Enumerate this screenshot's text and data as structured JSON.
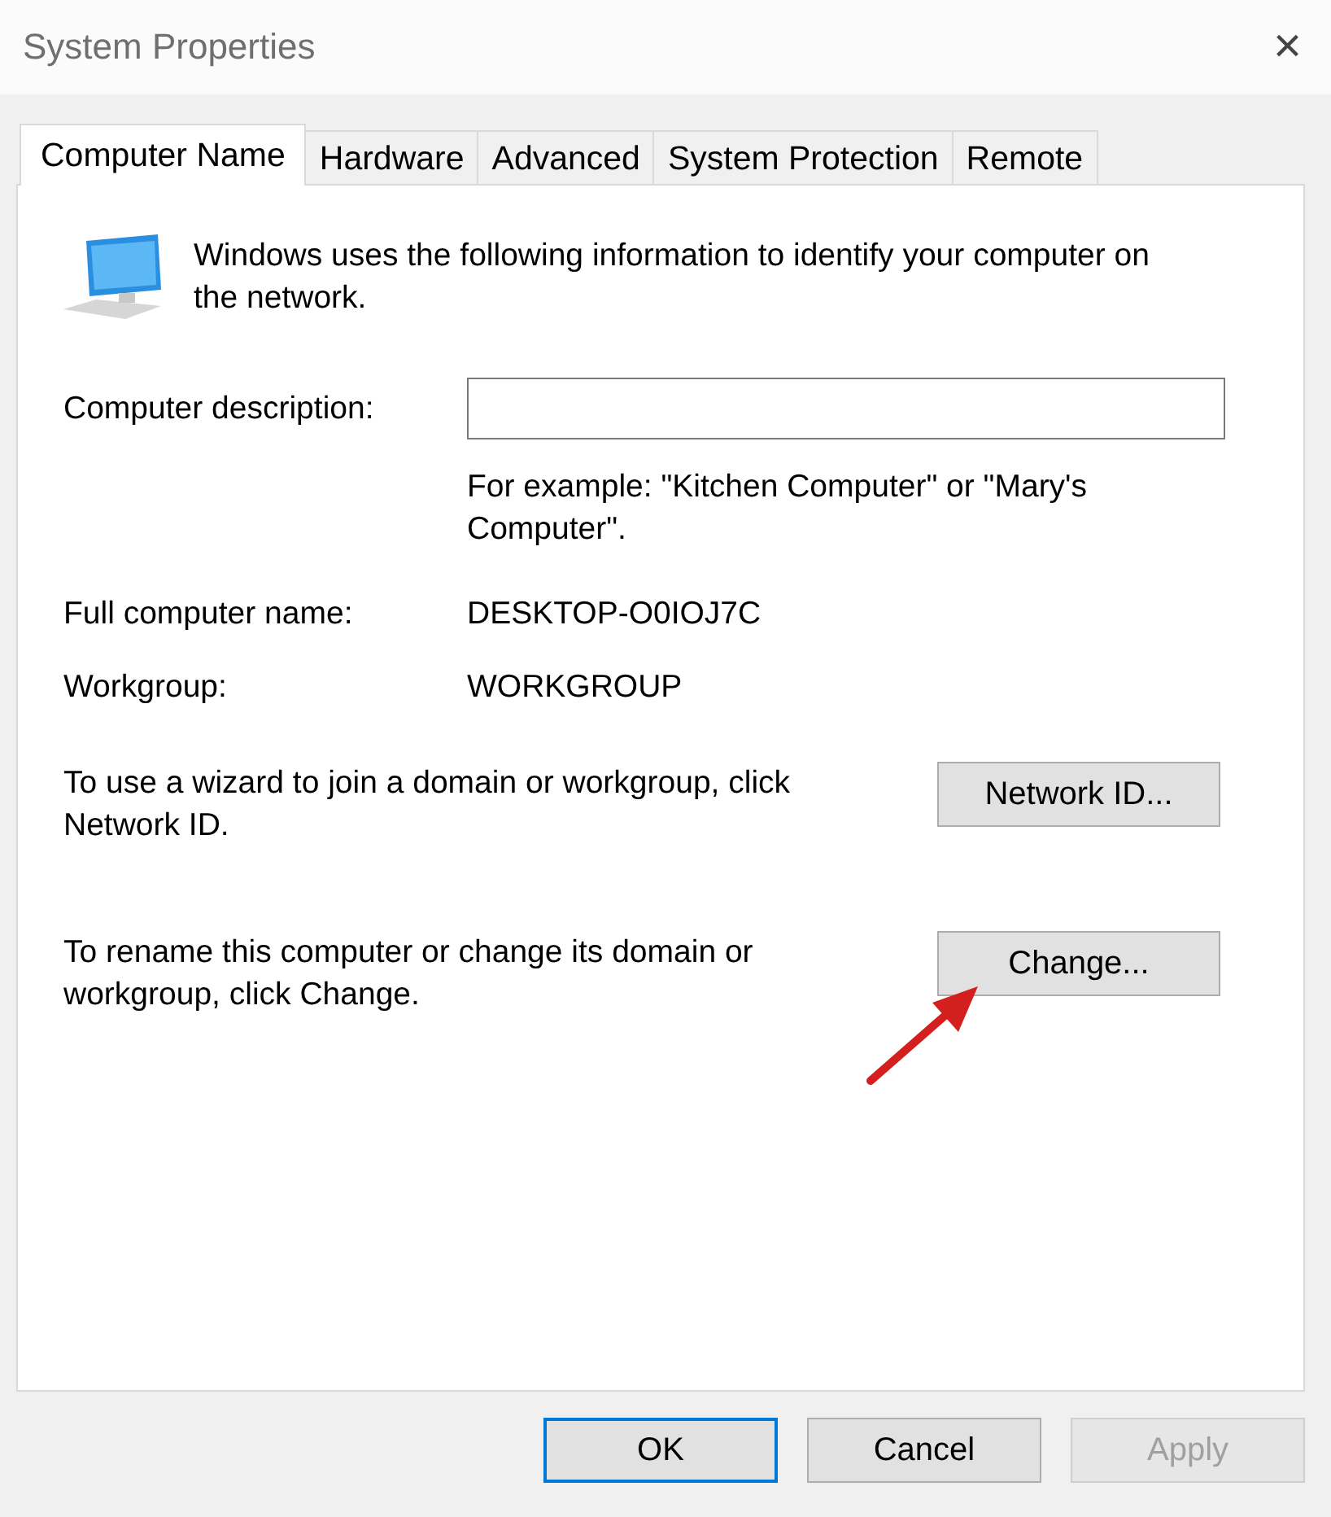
{
  "window": {
    "title": "System Properties",
    "close": "×"
  },
  "tabs": [
    {
      "label": "Computer Name",
      "selected": true
    },
    {
      "label": "Hardware",
      "selected": false
    },
    {
      "label": "Advanced",
      "selected": false
    },
    {
      "label": "System Protection",
      "selected": false
    },
    {
      "label": "Remote",
      "selected": false
    }
  ],
  "intro": "Windows uses the following information to identify your computer on the network.",
  "description": {
    "label": "Computer description:",
    "hint": "For example: \"Kitchen Computer\" or \"Mary's Computer\"."
  },
  "fields": [
    {
      "label": "Full computer name:",
      "value": "DESKTOP-O0IOJ7C"
    },
    {
      "label": "Workgroup:",
      "value": "WORKGROUP"
    }
  ],
  "actions": [
    {
      "text": "To use a wizard to join a domain or workgroup, click Network ID.",
      "button": "Network ID...",
      "annotated": false
    },
    {
      "text": "To rename this computer or change its domain or workgroup, click Change.",
      "button": "Change...",
      "annotated": true
    }
  ],
  "buttons": [
    {
      "label": "OK",
      "default": true,
      "disabled": false
    },
    {
      "label": "Cancel",
      "default": false,
      "disabled": false
    },
    {
      "label": "Apply",
      "default": false,
      "disabled": true
    }
  ]
}
